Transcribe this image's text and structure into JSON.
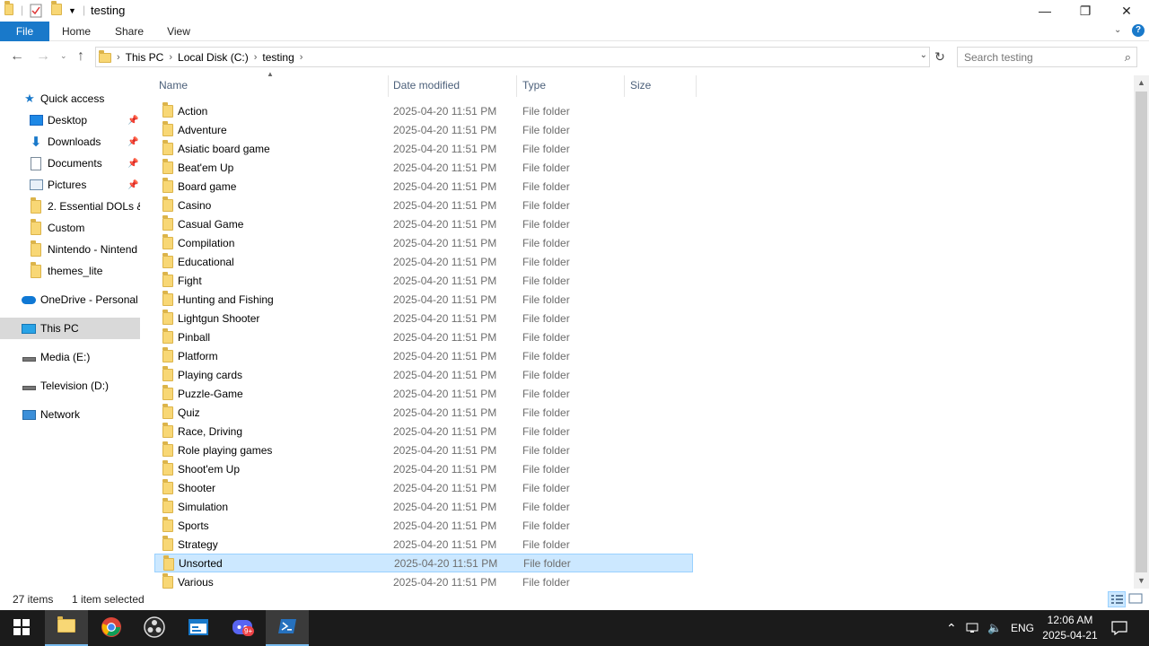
{
  "window": {
    "title": "testing",
    "minimize_glyph": "—",
    "restore_glyph": "❐",
    "close_glyph": "✕"
  },
  "ribbon": {
    "tabs": [
      "File",
      "Home",
      "Share",
      "View"
    ]
  },
  "address": {
    "breadcrumbs": [
      "This PC",
      "Local Disk (C:)",
      "testing"
    ]
  },
  "search": {
    "placeholder": "Search testing"
  },
  "nav_pane": {
    "items": [
      {
        "label": "Quick access",
        "icon": "star-icon",
        "pinned": false
      },
      {
        "label": "Desktop",
        "icon": "desktop-icon",
        "pinned": true
      },
      {
        "label": "Downloads",
        "icon": "download-icon",
        "pinned": true
      },
      {
        "label": "Documents",
        "icon": "documents-icon",
        "pinned": true
      },
      {
        "label": "Pictures",
        "icon": "pictures-icon",
        "pinned": true
      },
      {
        "label": "2. Essential DOLs &",
        "icon": "folder-icon",
        "pinned": false
      },
      {
        "label": "Custom",
        "icon": "folder-icon",
        "pinned": false
      },
      {
        "label": "Nintendo - Nintend",
        "icon": "folder-icon",
        "pinned": false
      },
      {
        "label": "themes_lite",
        "icon": "folder-icon",
        "pinned": false
      },
      {
        "label": "OneDrive - Personal",
        "icon": "cloud-icon",
        "pinned": false
      },
      {
        "label": "This PC",
        "icon": "computer-icon",
        "pinned": false,
        "selected": true
      },
      {
        "label": "Media (E:)",
        "icon": "drive-icon",
        "pinned": false
      },
      {
        "label": "Television (D:)",
        "icon": "drive-icon",
        "pinned": false
      },
      {
        "label": "Network",
        "icon": "network-icon",
        "pinned": false
      }
    ]
  },
  "columns": {
    "name": "Name",
    "date": "Date modified",
    "type": "Type",
    "size": "Size"
  },
  "files": [
    {
      "name": "Action",
      "date": "2025-04-20 11:51 PM",
      "type": "File folder"
    },
    {
      "name": "Adventure",
      "date": "2025-04-20 11:51 PM",
      "type": "File folder"
    },
    {
      "name": "Asiatic board game",
      "date": "2025-04-20 11:51 PM",
      "type": "File folder"
    },
    {
      "name": "Beat'em Up",
      "date": "2025-04-20 11:51 PM",
      "type": "File folder"
    },
    {
      "name": "Board game",
      "date": "2025-04-20 11:51 PM",
      "type": "File folder"
    },
    {
      "name": "Casino",
      "date": "2025-04-20 11:51 PM",
      "type": "File folder"
    },
    {
      "name": "Casual Game",
      "date": "2025-04-20 11:51 PM",
      "type": "File folder"
    },
    {
      "name": "Compilation",
      "date": "2025-04-20 11:51 PM",
      "type": "File folder"
    },
    {
      "name": "Educational",
      "date": "2025-04-20 11:51 PM",
      "type": "File folder"
    },
    {
      "name": "Fight",
      "date": "2025-04-20 11:51 PM",
      "type": "File folder"
    },
    {
      "name": "Hunting and Fishing",
      "date": "2025-04-20 11:51 PM",
      "type": "File folder"
    },
    {
      "name": "Lightgun Shooter",
      "date": "2025-04-20 11:51 PM",
      "type": "File folder"
    },
    {
      "name": "Pinball",
      "date": "2025-04-20 11:51 PM",
      "type": "File folder"
    },
    {
      "name": "Platform",
      "date": "2025-04-20 11:51 PM",
      "type": "File folder"
    },
    {
      "name": "Playing cards",
      "date": "2025-04-20 11:51 PM",
      "type": "File folder"
    },
    {
      "name": "Puzzle-Game",
      "date": "2025-04-20 11:51 PM",
      "type": "File folder"
    },
    {
      "name": "Quiz",
      "date": "2025-04-20 11:51 PM",
      "type": "File folder"
    },
    {
      "name": "Race, Driving",
      "date": "2025-04-20 11:51 PM",
      "type": "File folder"
    },
    {
      "name": "Role playing games",
      "date": "2025-04-20 11:51 PM",
      "type": "File folder"
    },
    {
      "name": "Shoot'em Up",
      "date": "2025-04-20 11:51 PM",
      "type": "File folder"
    },
    {
      "name": "Shooter",
      "date": "2025-04-20 11:51 PM",
      "type": "File folder"
    },
    {
      "name": "Simulation",
      "date": "2025-04-20 11:51 PM",
      "type": "File folder"
    },
    {
      "name": "Sports",
      "date": "2025-04-20 11:51 PM",
      "type": "File folder"
    },
    {
      "name": "Strategy",
      "date": "2025-04-20 11:51 PM",
      "type": "File folder"
    },
    {
      "name": "Unsorted",
      "date": "2025-04-20 11:51 PM",
      "type": "File folder",
      "selected": true
    },
    {
      "name": "Various",
      "date": "2025-04-20 11:51 PM",
      "type": "File folder"
    }
  ],
  "status": {
    "item_count": "27 items",
    "selection": "1 item selected"
  },
  "taskbar": {
    "apps": [
      "start-icon",
      "file-explorer-icon",
      "chrome-icon",
      "obs-icon",
      "window-app-icon",
      "discord-icon",
      "powershell-icon"
    ],
    "discord_badge": "9+",
    "language": "ENG",
    "time": "12:06 AM",
    "date": "2025-04-21"
  },
  "colors": {
    "accent": "#1979ca",
    "selection_bg": "#cce8ff",
    "selection_border": "#99d1ff",
    "header_text": "#4c607a",
    "secondary_text": "#6d6d6d",
    "taskbar": "#1b1b1b",
    "folder": "#f8d775"
  }
}
